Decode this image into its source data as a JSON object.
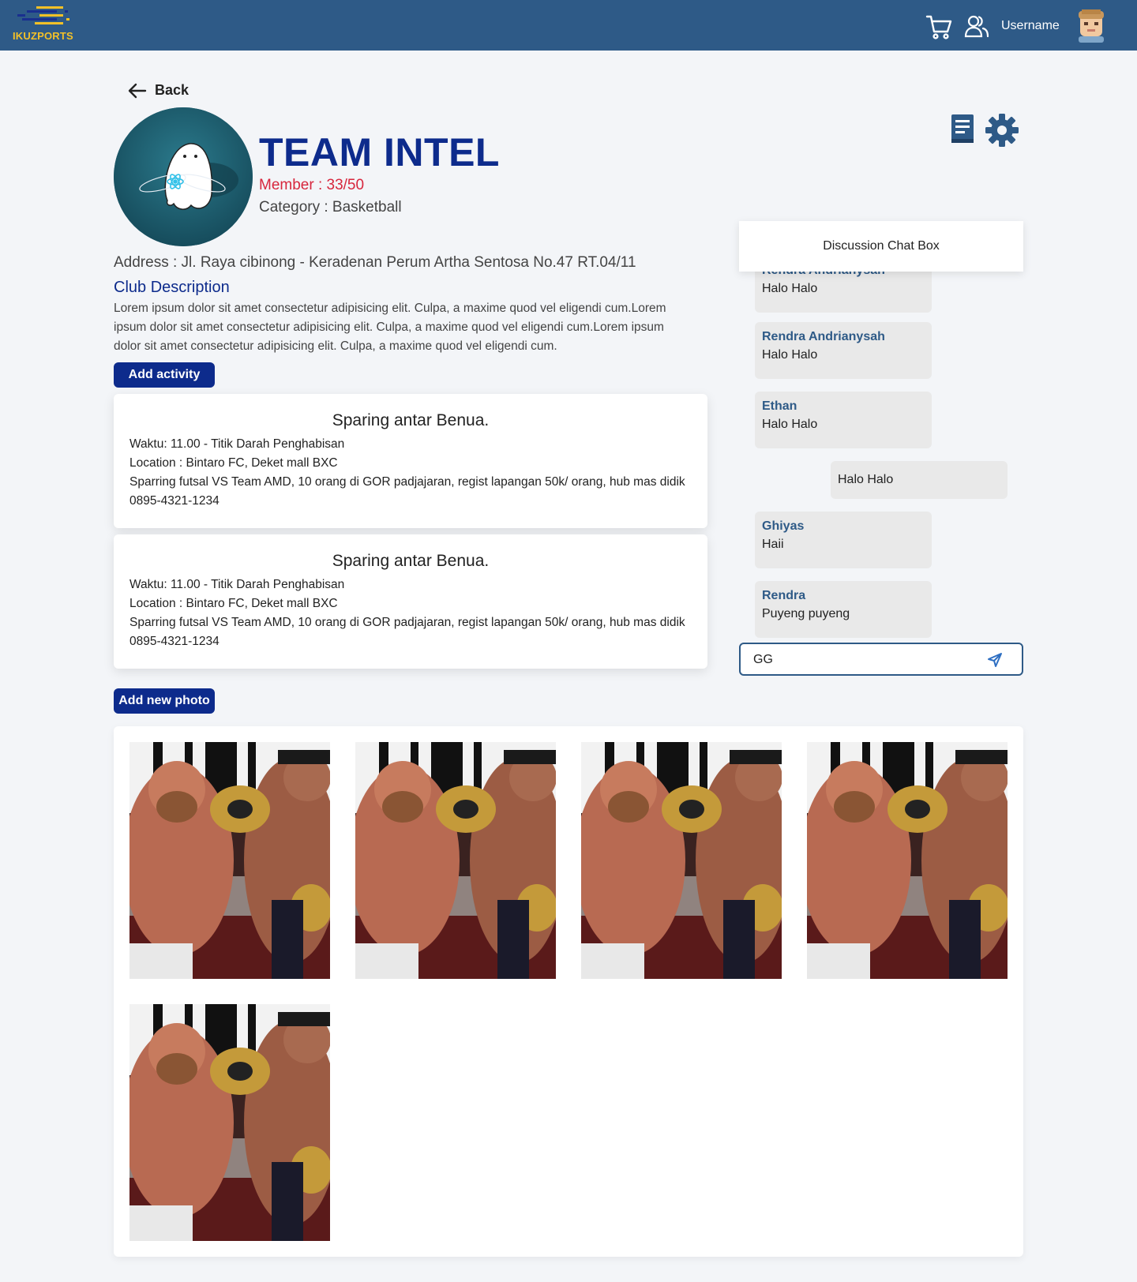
{
  "navbar": {
    "brand": "IKUZPORTS",
    "username": "Username",
    "icons": [
      "cart-icon",
      "users-icon",
      "avatar"
    ]
  },
  "back_label": "Back",
  "team": {
    "name": "TEAM INTEL",
    "member": "Member : 33/50",
    "category": "Category : Basketball",
    "address": "Address : Jl. Raya cibinong - Keradenan Perum Artha Sentosa No.47 RT.04/11",
    "description_title": "Club Description",
    "description": "Lorem ipsum dolor sit amet consectetur adipisicing elit. Culpa, a maxime quod vel eligendi cum.Lorem ipsum dolor sit amet consectetur adipisicing elit. Culpa, a maxime quod vel eligendi cum.Lorem ipsum dolor sit amet consectetur adipisicing elit. Culpa, a maxime quod vel eligendi cum."
  },
  "buttons": {
    "add_activity": "Add activity",
    "add_photo": "Add new photo"
  },
  "activities": [
    {
      "title": "Sparing antar Benua.",
      "time": "Waktu: 11.00 - Titik Darah Penghabisan",
      "location": "Location : Bintaro FC, Deket mall BXC",
      "detail": "Sparring futsal VS Team AMD, 10 orang di GOR padjajaran, regist lapangan 50k/ orang, hub mas didik 0895-4321-1234"
    },
    {
      "title": "Sparing antar Benua.",
      "time": "Waktu: 11.00 - Titik Darah Penghabisan",
      "location": "Location : Bintaro FC, Deket mall BXC",
      "detail": "Sparring futsal VS Team AMD, 10 orang di GOR padjajaran, regist lapangan 50k/ orang, hub mas didik 0895-4321-1234"
    }
  ],
  "chat": {
    "title": "Discussion Chat Box",
    "messages": [
      {
        "sender": "Rendra Andrianysah",
        "text": "Halo Halo",
        "side": "left"
      },
      {
        "sender": "Rendra Andrianysah",
        "text": "Halo Halo",
        "side": "left"
      },
      {
        "sender": "Ethan",
        "text": "Halo Halo",
        "side": "left"
      },
      {
        "sender": "",
        "text": "Halo Halo",
        "side": "right"
      },
      {
        "sender": "Ghiyas",
        "text": "Haii",
        "side": "left"
      },
      {
        "sender": "Rendra",
        "text": "Puyeng puyeng",
        "side": "left"
      }
    ],
    "input_value": "GG"
  },
  "gallery": {
    "photo_count": 5
  },
  "colors": {
    "navbar": "#2e5a87",
    "brand_yellow": "#f3c128",
    "primary_button": "#0d2b8c",
    "member_red": "#d7263d",
    "sender_blue": "#2e5a87"
  }
}
